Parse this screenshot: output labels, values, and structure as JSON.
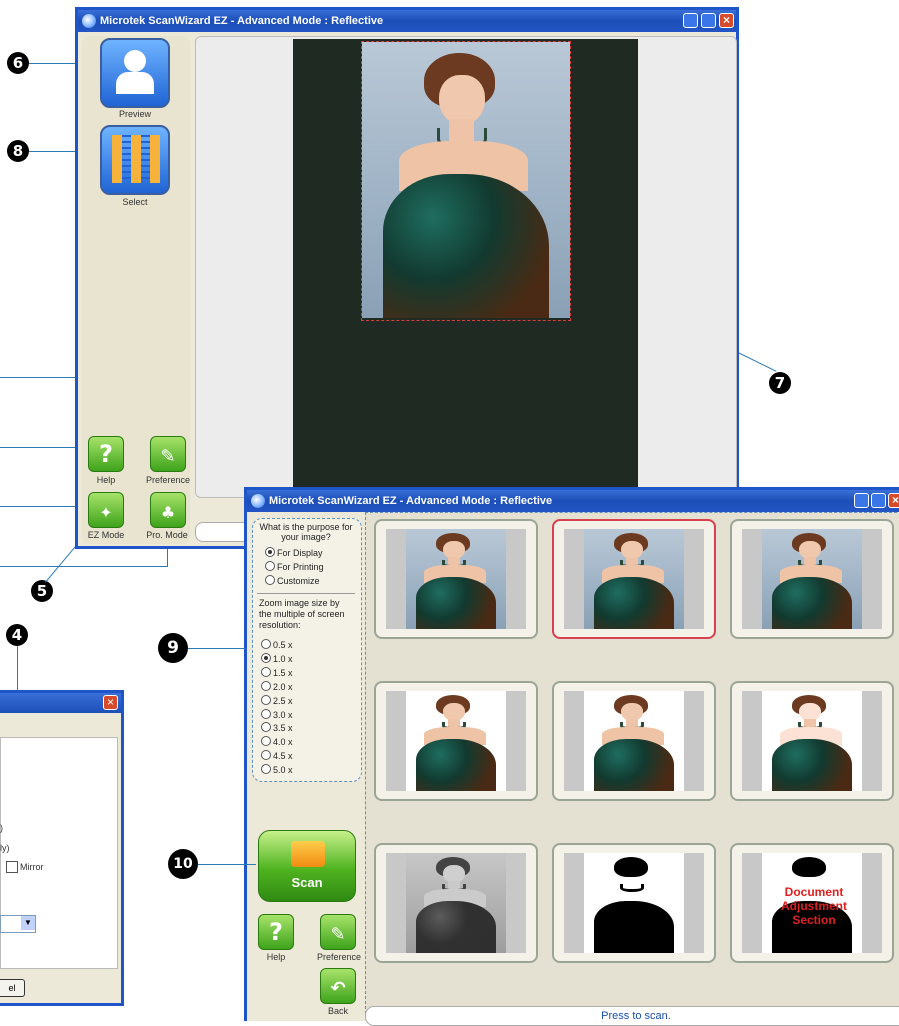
{
  "main_window": {
    "title": "Microtek ScanWizard EZ - Advanced Mode : Reflective",
    "preview_label": "Preview",
    "select_label": "Select",
    "help_label": "Help",
    "preference_label": "Preference",
    "ezmode_label": "EZ Mode",
    "promode_label": "Pro. Mode"
  },
  "select_window": {
    "title": "Microtek ScanWizard EZ - Advanced Mode : Reflective",
    "purpose_heading": "What is the purpose for your image?",
    "purpose_options": [
      "For Display",
      "For Printing",
      "Customize"
    ],
    "purpose_selected": "For Display",
    "zoom_heading": "Zoom image size by the multiple of screen resolution:",
    "zoom_options": [
      "0.5 x",
      "1.0 x",
      "1.5 x",
      "2.0 x",
      "2.5 x",
      "3.0 x",
      "3.5 x",
      "4.0 x",
      "4.5 x",
      "5.0 x"
    ],
    "zoom_selected": "1.0 x",
    "scan_label": "Scan",
    "help_label": "Help",
    "preference_label": "Preference",
    "back_label": "Back",
    "status": "Press to scan.",
    "doc_overlay": "Document Adjustment Section"
  },
  "dialog_fragment": {
    "mirror_label": "Mirror",
    "cancel_fragment": "el",
    "line1": ")",
    "line2": "ly)"
  },
  "callouts": {
    "c6": "6",
    "c8": "8",
    "c7": "7",
    "c5": "5",
    "c4": "4",
    "c9": "9",
    "c10": "10"
  },
  "colors": {
    "titlebar": "#2356c4",
    "window_bg": "#ece9d8",
    "scan_button": "#4fb31f",
    "selected_thumb_border": "#d8414e"
  }
}
